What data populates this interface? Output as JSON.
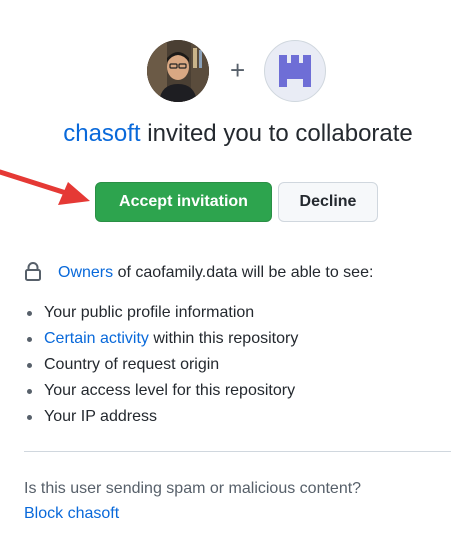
{
  "avatars": {
    "user_icon": "user-avatar-photo",
    "separator": "+",
    "repo_icon": "repo-identicon"
  },
  "headline": {
    "inviter": "chasoft",
    "text": " invited you to collaborate"
  },
  "actions": {
    "accept_label": "Accept invitation",
    "decline_label": "Decline"
  },
  "privacy": {
    "owners_link": "Owners",
    "owners_text": " of caofamily.data will be able to see:",
    "items": [
      {
        "link": "",
        "text": "Your public profile information"
      },
      {
        "link": "Certain activity",
        "text": " within this repository"
      },
      {
        "link": "",
        "text": "Country of request origin"
      },
      {
        "link": "",
        "text": "Your access level for this repository"
      },
      {
        "link": "",
        "text": "Your IP address"
      }
    ]
  },
  "report": {
    "question": "Is this user sending spam or malicious content?",
    "block_label": "Block chasoft"
  },
  "colors": {
    "accent_link": "#0969da",
    "accept_green": "#2da44e",
    "arrow_red": "#e53935",
    "identicon": "#6e6ed6"
  }
}
